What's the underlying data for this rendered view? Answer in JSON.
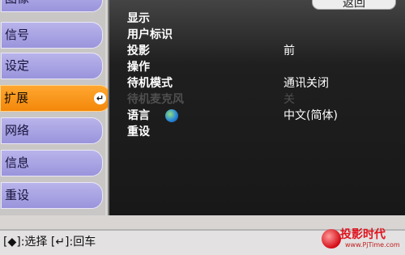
{
  "nav": {
    "items": [
      {
        "label": "图像"
      },
      {
        "label": "信号"
      },
      {
        "label": "设定"
      },
      {
        "label": "扩展",
        "active": true
      },
      {
        "label": "网络"
      },
      {
        "label": "信息"
      },
      {
        "label": "重设"
      }
    ],
    "enter_symbol": "↵"
  },
  "panel": {
    "back_label": "返回",
    "rows": [
      {
        "label": "显示",
        "value": ""
      },
      {
        "label": "用户标识",
        "value": ""
      },
      {
        "label": "投影",
        "value": "前"
      },
      {
        "label": "操作",
        "value": ""
      },
      {
        "label": "待机模式",
        "value": "通讯关闭"
      },
      {
        "label": "待机麦克风",
        "value": "关",
        "disabled": true
      },
      {
        "label": "语言",
        "value": "中文(简体)",
        "icon": "globe-icon"
      },
      {
        "label": "重设",
        "value": ""
      }
    ]
  },
  "help": {
    "text": "[◆]:选择 [↵]:回车"
  },
  "watermark": {
    "name": "投影时代",
    "site": "www.PjTime.com"
  },
  "colors": {
    "nav_item": "#a7a2e2",
    "nav_active": "#f79a1c",
    "panel_bg": "#1c1c1c"
  }
}
